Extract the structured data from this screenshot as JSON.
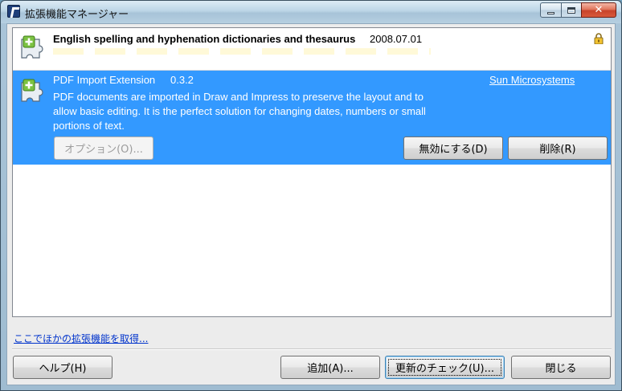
{
  "window": {
    "title": "拡張機能マネージャー",
    "controls": {
      "minimize_icon": "minimize-icon",
      "maximize_icon": "maximize-icon",
      "close_icon": "close-icon"
    }
  },
  "extensions": [
    {
      "name": "English spelling and hyphenation dictionaries and thesaurus",
      "version": "2008.07.01",
      "icon": "puzzle-piece-icon",
      "locked": true,
      "selected": false
    },
    {
      "name": "PDF Import Extension",
      "version": "0.3.2",
      "publisher": "Sun Microsystems",
      "description": "PDF documents are imported in Draw and Impress to preserve the layout and to allow basic editing. It is the perfect solution for changing dates, numbers or small portions of text.",
      "icon": "puzzle-piece-icon",
      "selected": true,
      "buttons": {
        "options": "オプション(O)...",
        "disable": "無効にする(D)",
        "remove": "削除(R)"
      }
    }
  ],
  "footer": {
    "more_link": "ここでほかの拡張機能を取得...",
    "help": "ヘルプ(H)",
    "add": "追加(A)...",
    "check_updates": "更新のチェック(U)...",
    "close": "閉じる"
  },
  "colors": {
    "selection": "#3399ff",
    "link": "#0033cc"
  }
}
